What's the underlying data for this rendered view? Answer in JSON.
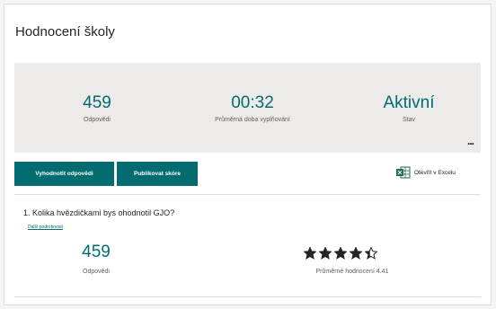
{
  "form": {
    "title": "Hodnocení školy"
  },
  "summary": {
    "responses_value": "459",
    "responses_label": "Odpovědi",
    "avg_time_value": "00:32",
    "avg_time_label": "Průměrná doba vyplňování",
    "status_value": "Aktivní",
    "status_label": "Stav",
    "more_label": "..."
  },
  "toolbar": {
    "review_button": "Vyhodnotit odpovědi",
    "publish_button": "Publikovat skóre",
    "excel_label": "Otevřít v Excelu"
  },
  "question": {
    "title": "1.  Kolika hvězdičkami bys ohodnotil GJO?",
    "more_details": "Další podrobnosti",
    "responses_value": "459",
    "responses_label": "Odpovědi",
    "average_label": "Průměrné hodnocení 4.41",
    "rating": 4.41,
    "rating_max": 5
  },
  "colors": {
    "accent": "#036c70",
    "excel_green": "#1d6f42"
  }
}
